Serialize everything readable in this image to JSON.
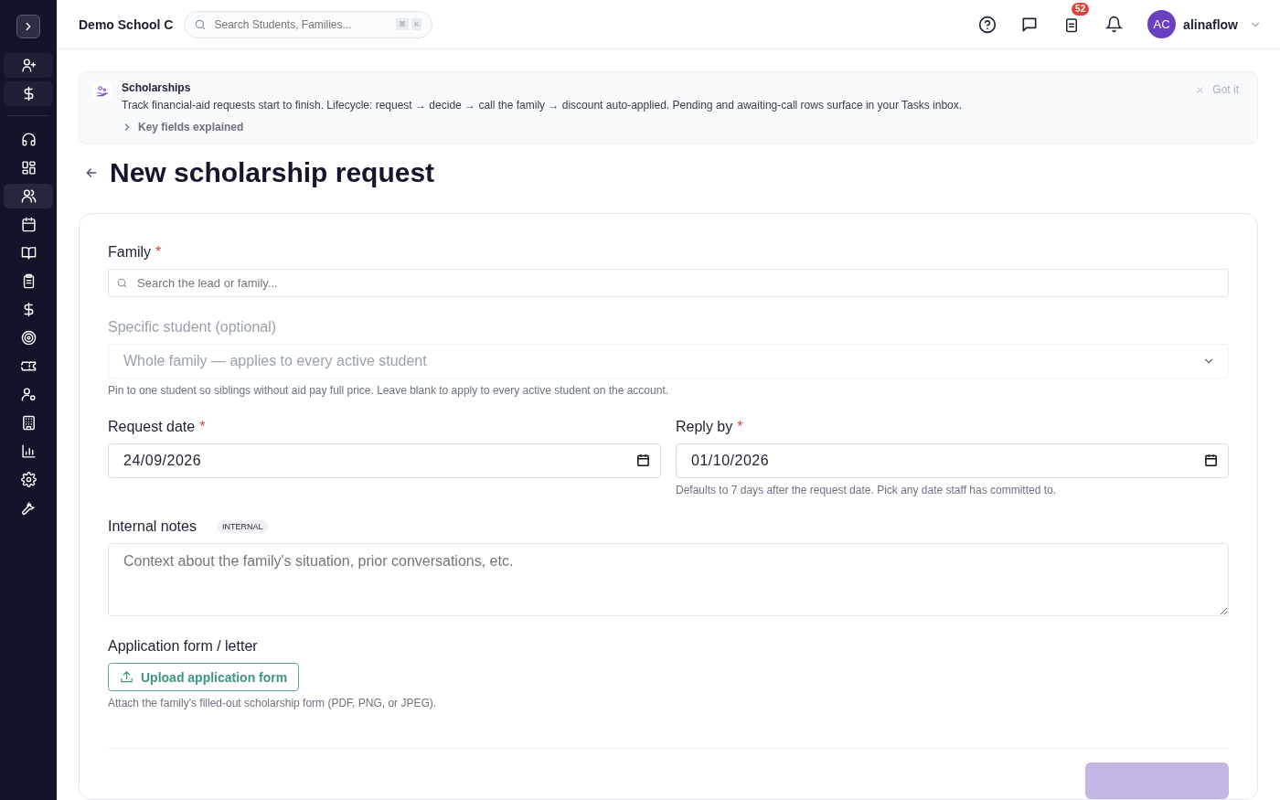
{
  "sidebar": {
    "items": [
      {
        "selected": false
      },
      {
        "selected": false
      },
      {
        "selected": true
      },
      {
        "selected": false
      },
      {
        "selected": false
      },
      {
        "selected": false
      },
      {
        "selected": false
      },
      {
        "selected": false
      },
      {
        "selected": false
      },
      {
        "selected": false
      },
      {
        "selected": false
      },
      {
        "selected": false
      },
      {
        "selected": false
      },
      {
        "selected": false
      }
    ]
  },
  "topbar": {
    "school": "Demo School C",
    "search": {
      "placeholder": "Search Students, Families...",
      "keys": [
        "⌘",
        "K"
      ]
    },
    "tasks_badge": "52",
    "user": {
      "initials": "AC",
      "name": "alinaflow"
    }
  },
  "banner": {
    "title": "Scholarships",
    "text": "Track financial-aid requests start to finish. Lifecycle: request → decide → call the family → discount auto-applied. Pending and awaiting-call rows surface in your Tasks inbox.",
    "expander": {
      "label": "Key fields explained",
      "expanded": false
    },
    "dismiss": "Got it"
  },
  "page_title": "New scholarship request",
  "form": {
    "family": {
      "label": "Family",
      "required_mark": "*",
      "placeholder": "Search the lead or family..."
    },
    "student": {
      "label": "Specific student (optional)",
      "disabled": true,
      "value": "Whole family — applies to every active student",
      "hint": "Pin to one student so siblings without aid pay full price. Leave blank to apply to every active student on the account."
    },
    "dates": [
      {
        "label": "Request date",
        "required_mark": "*",
        "value": "24/09/2026"
      },
      {
        "label": "Reply by",
        "required_mark": "*",
        "value": "01/10/2026",
        "hint": "Defaults to 7 days after the request date. Pick any date staff has committed to."
      }
    ],
    "notes": {
      "label": "Internal notes",
      "badge": "INTERNAL",
      "placeholder": "Context about the family's situation, prior conversations, etc."
    },
    "upload": {
      "label": "Application form / letter",
      "button": "Upload application form",
      "hint": "Attach the family's filled-out scholarship form (PDF, PNG, or JPEG)."
    },
    "submit": {
      "disabled": true
    }
  }
}
